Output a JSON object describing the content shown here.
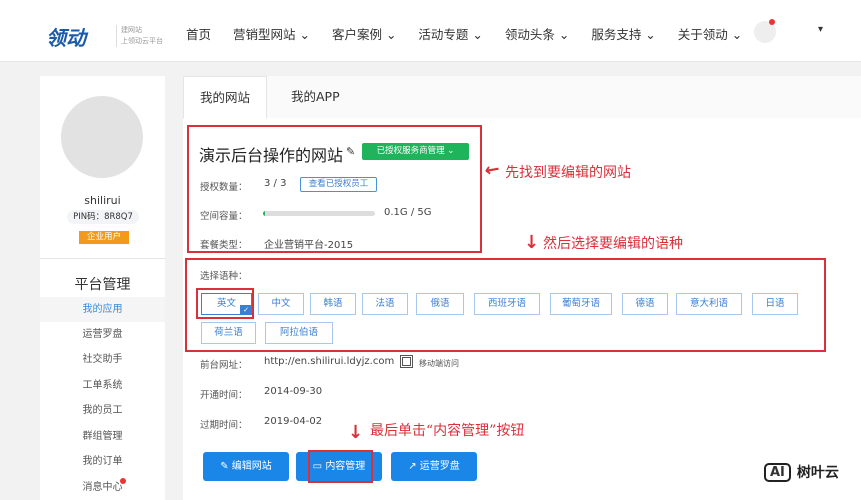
{
  "header": {
    "logo": "领动",
    "logo_sub": [
      "建网站",
      "上领动云平台"
    ],
    "nav": [
      "首页",
      "营销型网站 ⌄",
      "客户案例 ⌄",
      "活动专题 ⌄",
      "领动头条 ⌄",
      "服务支持 ⌄",
      "关于领动 ⌄"
    ],
    "user_caret": "▾"
  },
  "sidebar": {
    "username": "shilirui",
    "pin": "PIN码：8R8Q7",
    "badge": "企业用户",
    "section": "平台管理",
    "items": [
      "我的应用",
      "运营罗盘",
      "社交助手",
      "工单系统",
      "我的员工",
      "群组管理",
      "我的订单",
      "消息中心"
    ]
  },
  "tabs": [
    "我的网站",
    "我的APP"
  ],
  "site": {
    "title": "演示后台操作的网站",
    "auth_badge": "已授权服务商管理 ⌄",
    "auth_count_label": "授权数量：",
    "auth_count": "3 / 3",
    "view_staff": "查看已授权员工",
    "space_label": "空间容量：",
    "space": "0.1G / 5G",
    "space_fraction": 0.02,
    "plan_label": "套餐类型：",
    "plan": "企业营销平台-2015"
  },
  "languages": {
    "label": "选择语种：",
    "items": [
      "英文",
      "中文",
      "韩语",
      "法语",
      "俄语",
      "西班牙语",
      "葡萄牙语",
      "德语",
      "意大利语",
      "日语",
      "荷兰语",
      "阿拉伯语"
    ],
    "selected": "英文"
  },
  "info": {
    "url_label": "前台网址：",
    "url": "http://en.shilirui.ldyjz.com",
    "mobile": "移动端访问",
    "open_label": "开通时间：",
    "open": "2014-09-30",
    "expire_label": "过期时间：",
    "expire": "2019-04-02"
  },
  "buttons": {
    "edit": "编辑网站",
    "content": "内容管理",
    "compass": "运营罗盘"
  },
  "annotations": {
    "a1": "先找到要编辑的网站",
    "a2": "然后选择要编辑的语种",
    "a3": "最后单击“内容管理”按钮"
  },
  "watermark": {
    "logo": "AI",
    "text": "树叶云"
  },
  "colors": {
    "accent": "#1a86e8",
    "annotation": "#d9303a",
    "success": "#1db45c"
  }
}
